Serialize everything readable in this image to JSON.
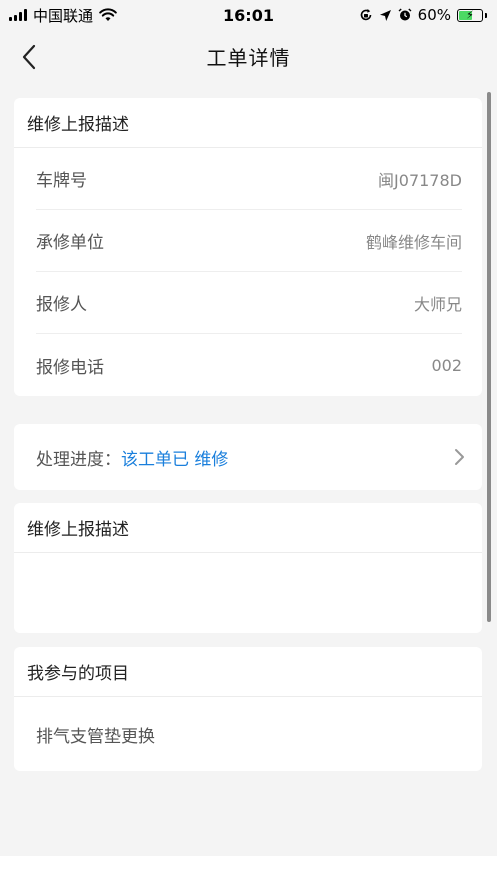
{
  "status_bar": {
    "carrier": "中国联通",
    "time": "16:01",
    "battery_percent": "60%",
    "battery_level": 0.6
  },
  "nav": {
    "title": "工单详情",
    "back_icon": "chevron-left-icon"
  },
  "report_card": {
    "header": "维修上报描述",
    "rows": [
      {
        "label": "车牌号",
        "value": "闽J07178D"
      },
      {
        "label": "承修单位",
        "value": "鹤峰维修车间"
      },
      {
        "label": "报修人",
        "value": "大师兄"
      },
      {
        "label": "报修电话",
        "value": "002"
      }
    ]
  },
  "progress": {
    "label": "处理进度：",
    "value": "该工单已 维修"
  },
  "description_card": {
    "header": "维修上报描述"
  },
  "project_card": {
    "header": "我参与的项目",
    "item": "排气支管垫更换"
  },
  "colors": {
    "accent": "#1a7fdc",
    "background": "#f4f4f4",
    "battery": "#4cd964"
  }
}
